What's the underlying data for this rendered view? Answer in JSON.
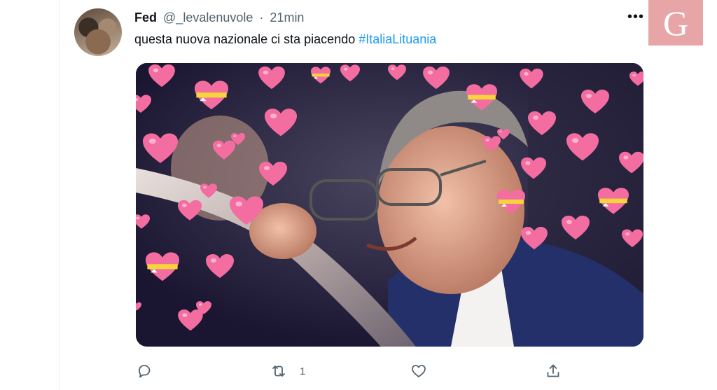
{
  "tweet": {
    "author_name": "Fed",
    "author_handle": "@_levalenuvole",
    "separator": "·",
    "timestamp": "21min",
    "text_plain": "questa nuova nazionale ci sta piacendo ",
    "hashtag": "#ItaliaLituania",
    "media_description_icon": "photo-image",
    "more_icon": "more-horizontal-icon"
  },
  "actions": {
    "reply_icon": "reply-icon",
    "retweet_icon": "retweet-icon",
    "retweet_count": "1",
    "like_icon": "heart-icon",
    "share_icon": "share-icon"
  },
  "brand": {
    "logo_letter": "G",
    "color": "#e8a5a8"
  },
  "colors": {
    "link": "#1d9bf0",
    "muted": "#536471",
    "text": "#0f1419"
  }
}
